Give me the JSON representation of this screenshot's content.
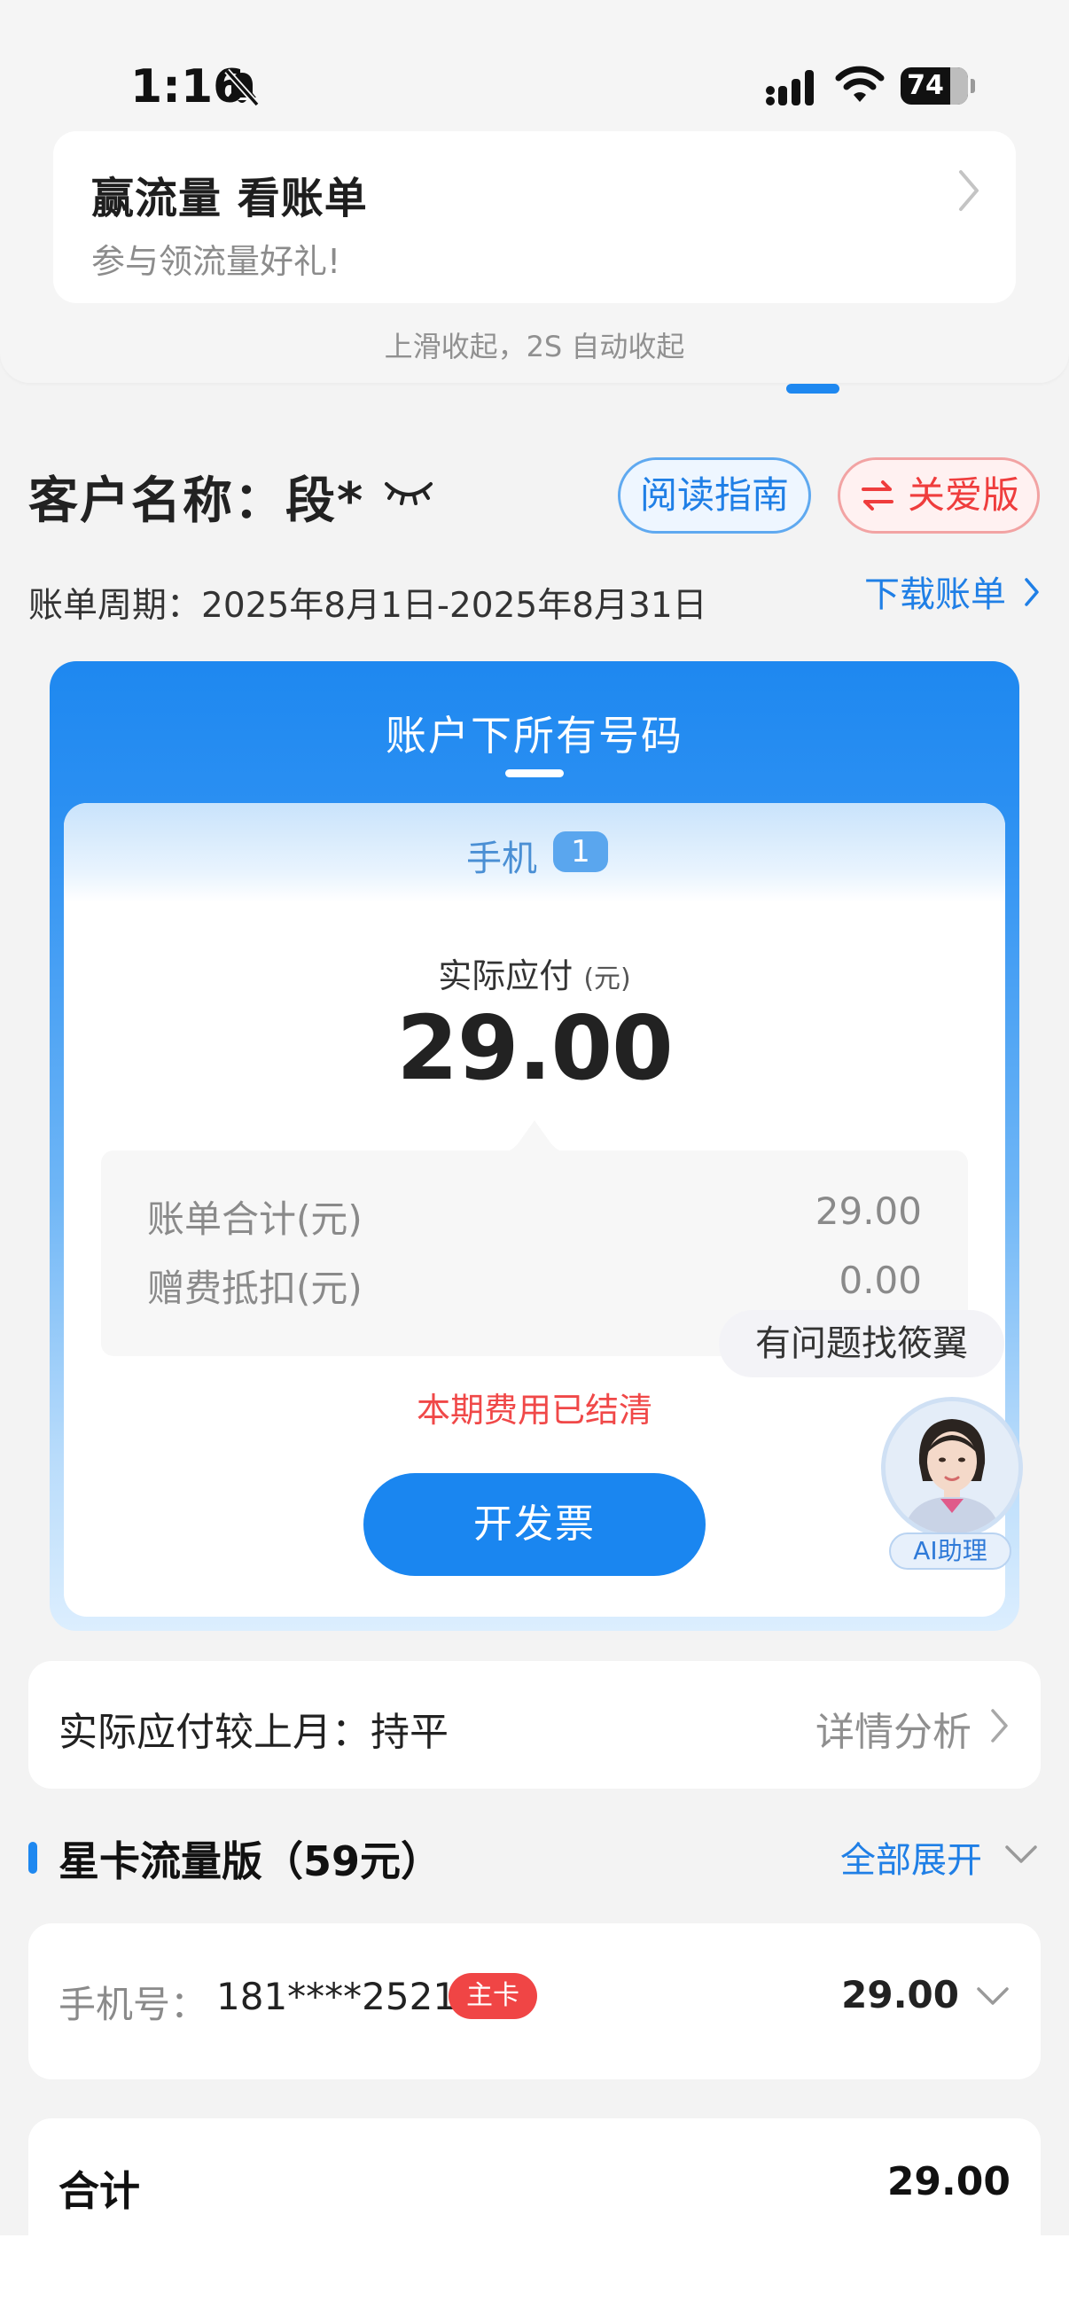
{
  "status_bar": {
    "time": "1:16",
    "battery": "74",
    "battery_level_percent": 74
  },
  "promo": {
    "title": "赢流量 看账单",
    "subtitle": "参与领流量好礼!",
    "hint": "上滑收起，2S 自动收起"
  },
  "header": {
    "customer_label": "客户名称：段*",
    "guide_button": "阅读指南",
    "care_button": "关爱版",
    "period": "账单周期：2025年8月1日-2025年8月31日",
    "download_link": "下载账单"
  },
  "bill_card": {
    "title": "账户下所有号码",
    "tab_label": "手机",
    "tab_count": "1",
    "due_label": "实际应付",
    "due_unit": "(元)",
    "due_amount": "29.00",
    "rows": [
      {
        "label": "账单合计(元)",
        "value": "29.00"
      },
      {
        "label": "赠费抵扣(元)",
        "value": "0.00"
      }
    ],
    "paid_status": "本期费用已结清",
    "invoice_button": "开发票"
  },
  "assistant": {
    "bubble": "有问题找筱翼",
    "tag": "AI助理"
  },
  "compare": {
    "label": "实际应付较上月：持平",
    "link": "详情分析"
  },
  "plan": {
    "title": "星卡流量版（59元）",
    "expand": "全部展开",
    "phone_label": "手机号：",
    "phone_number": "181****2521",
    "main_badge": "主卡",
    "phone_amount": "29.00"
  },
  "total": {
    "label": "合计",
    "amount": "29.00"
  },
  "colors": {
    "accent": "#1e88f0",
    "danger": "#f04848",
    "care": "#ef3d3d",
    "background": "#f3f3f3"
  }
}
